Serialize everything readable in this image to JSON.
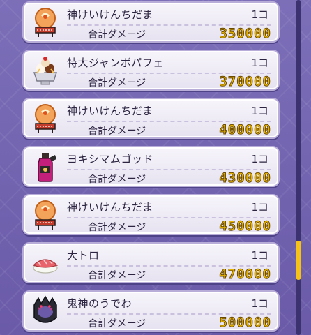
{
  "list": {
    "rows": [
      {
        "name": "神けいけんちだま",
        "qty": "1コ",
        "damage_label": "合計ダメージ",
        "damage": "350000",
        "icon": "spirit-orb-icon"
      },
      {
        "name": "特大ジャンボパフェ",
        "qty": "1コ",
        "damage_label": "合計ダメージ",
        "damage": "370000",
        "icon": "parfait-icon"
      },
      {
        "name": "神けいけんちだま",
        "qty": "1コ",
        "damage_label": "合計ダメージ",
        "damage": "400000",
        "icon": "spirit-orb-icon"
      },
      {
        "name": "ヨキシマムゴッド",
        "qty": "1コ",
        "damage_label": "合計ダメージ",
        "damage": "430000",
        "icon": "potion-bottle-icon"
      },
      {
        "name": "神けいけんちだま",
        "qty": "1コ",
        "damage_label": "合計ダメージ",
        "damage": "450000",
        "icon": "spirit-orb-icon"
      },
      {
        "name": "大トロ",
        "qty": "1コ",
        "damage_label": "合計ダメージ",
        "damage": "470000",
        "icon": "sushi-icon"
      },
      {
        "name": "鬼神のうでわ",
        "qty": "1コ",
        "damage_label": "合計ダメージ",
        "damage": "500000",
        "icon": "demon-bracelet-icon"
      }
    ]
  },
  "colors": {
    "background": "#6a5aa8",
    "damage_value": "#e6b400",
    "scroll_thumb": "#f6c21a"
  }
}
